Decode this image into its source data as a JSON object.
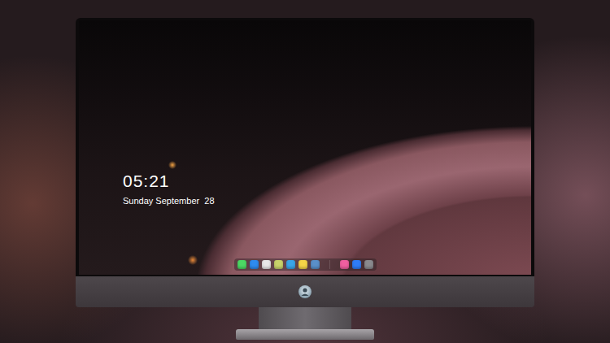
{
  "screen": {
    "time": "05:21",
    "date": "Sunday September  28"
  },
  "dock": [
    {
      "kind": "app",
      "color": "#4cd964"
    },
    {
      "kind": "app",
      "color": "#2e8bef"
    },
    {
      "kind": "app",
      "color": "#e8e8e8"
    },
    {
      "kind": "app",
      "color": "#c9d36a"
    },
    {
      "kind": "app",
      "color": "#3aa5e8"
    },
    {
      "kind": "app",
      "color": "#f5d547"
    },
    {
      "kind": "app",
      "color": "#5a8fc9"
    },
    {
      "kind": "separator"
    },
    {
      "kind": "app",
      "color": "#f05fa0"
    },
    {
      "kind": "app",
      "color": "#2f7cf6"
    },
    {
      "kind": "app",
      "color": "#8a8a8e"
    }
  ]
}
